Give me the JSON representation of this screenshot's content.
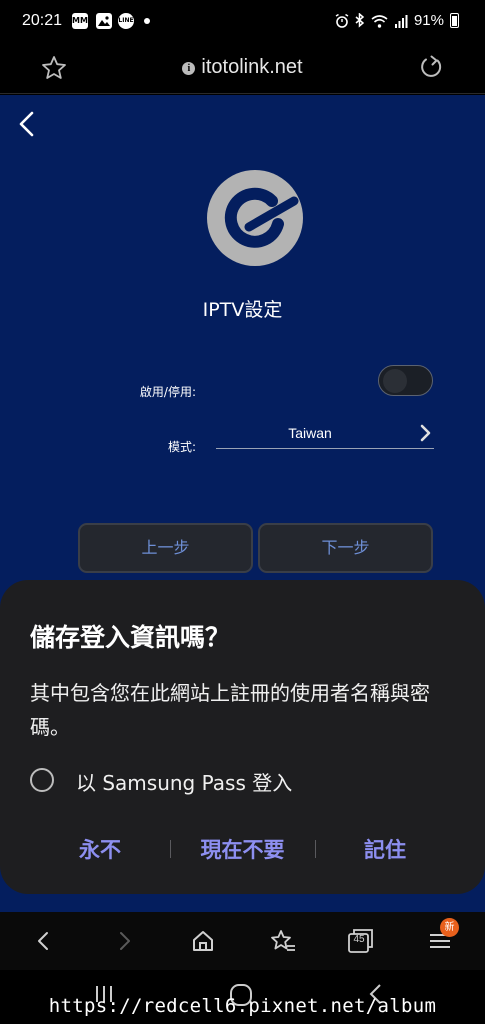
{
  "status_bar": {
    "time": "20:21",
    "battery": "91%",
    "notification_icons": [
      "mm-icon",
      "gallery-icon",
      "line-icon"
    ]
  },
  "browser": {
    "url": "itotolink.net",
    "tab_count": "45",
    "new_badge": "新"
  },
  "page": {
    "title": "IPTV設定",
    "enable_label": "啟用/停用:",
    "mode_label": "模式:",
    "mode_value": "Taiwan",
    "prev_button": "上一步",
    "next_button": "下一步",
    "toggle_on": false
  },
  "dialog": {
    "title": "儲存登入資訊嗎？",
    "body": "其中包含您在此網站上註冊的使用者名稱與密碼。",
    "radio_label": "以 Samsung Pass 登入",
    "never_button": "永不",
    "not_now_button": "現在不要",
    "remember_button": "記住"
  },
  "watermark": "https://redcell6.pixnet.net/album",
  "colors": {
    "page_bg": "#041e5e",
    "button_text": "#6e8fd6",
    "dialog_action": "#8d8ff0",
    "badge": "#e8601c"
  }
}
